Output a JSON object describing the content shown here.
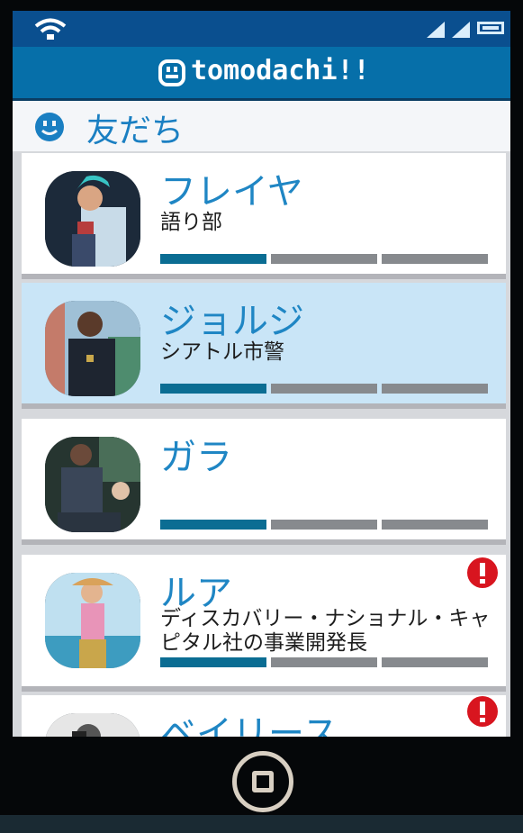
{
  "app": {
    "title": "tomodachi!!"
  },
  "section": {
    "title": "友だち"
  },
  "friends": [
    {
      "name": "フレイヤ",
      "role": "語り部",
      "progress_segments_filled": 1,
      "progress_segments_total": 3,
      "alert": false,
      "selected": false
    },
    {
      "name": "ジョルジ",
      "role": "シアトル市警",
      "progress_segments_filled": 1,
      "progress_segments_total": 3,
      "alert": false,
      "selected": true
    },
    {
      "name": "ガラ",
      "role": "",
      "progress_segments_filled": 1,
      "progress_segments_total": 3,
      "alert": false,
      "selected": false
    },
    {
      "name": "ルア",
      "role": "ディスカバリー・ナショナル・キャピタル社の事業開発長",
      "progress_segments_filled": 1,
      "progress_segments_total": 3,
      "alert": true,
      "selected": false
    },
    {
      "name": "ベイリース",
      "role": "",
      "progress_segments_filled": 1,
      "progress_segments_total": 3,
      "alert": true,
      "selected": false
    }
  ],
  "colors": {
    "header_blue": "#066fa9",
    "status_bar": "#0a4f8f",
    "accent_name": "#1f86c4",
    "progress_filled": "#0b6d93",
    "progress_empty": "#878a8e",
    "selected_row": "#c9e5f7",
    "alert_red": "#d8151f"
  },
  "icons": {
    "status_bar": [
      "wifi-icon",
      "signal-icon",
      "signal-icon",
      "battery-icon"
    ],
    "header": "smiley-logo-icon",
    "section": "smiley-icon",
    "alert": "exclamation-alert-icon",
    "home": "home-button-icon"
  }
}
